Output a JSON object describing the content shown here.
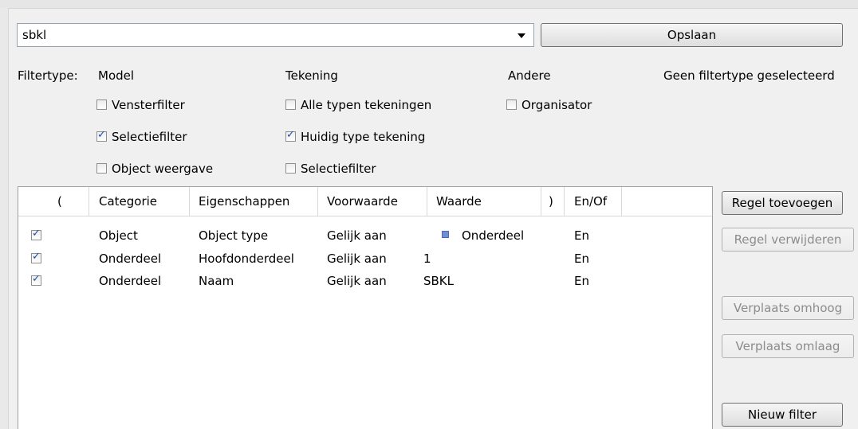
{
  "filter_name": "sbkl",
  "save_label": "Opslaan",
  "filtertype": {
    "label": "Filtertype:",
    "groups": {
      "model": "Model",
      "drawing": "Tekening",
      "other": "Andere",
      "none_selected": "Geen filtertype geselecteerd"
    },
    "model_options": [
      {
        "label": "Vensterfilter",
        "checked": false
      },
      {
        "label": "Selectiefilter",
        "checked": true
      },
      {
        "label": "Object weergave",
        "checked": false
      }
    ],
    "drawing_options": [
      {
        "label": "Alle typen tekeningen",
        "checked": false
      },
      {
        "label": "Huidig type tekening",
        "checked": true
      },
      {
        "label": "Selectiefilter",
        "checked": false
      }
    ],
    "other_options": [
      {
        "label": "Organisator",
        "checked": false
      }
    ]
  },
  "table": {
    "columns": [
      "(",
      "Categorie",
      "Eigenschappen",
      "Voorwaarde",
      "Waarde",
      ")",
      "En/Of"
    ],
    "rows": [
      {
        "checked": true,
        "category": "Object",
        "property": "Object type",
        "condition": "Gelijk aan",
        "value": "Onderdeel",
        "value_icon": "part-icon",
        "andor": "En"
      },
      {
        "checked": true,
        "category": "Onderdeel",
        "property": "Hoofdonderdeel",
        "condition": "Gelijk aan",
        "value": "1",
        "andor": "En"
      },
      {
        "checked": true,
        "category": "Onderdeel",
        "property": "Naam",
        "condition": "Gelijk aan",
        "value": "SBKL",
        "andor": "En"
      }
    ]
  },
  "actions": {
    "add_row": "Regel toevoegen",
    "remove_row": "Regel verwijderen",
    "move_up": "Verplaats omhoog",
    "move_down": "Verplaats omlaag",
    "new_filter": "Nieuw filter"
  },
  "colors": {
    "check_mark": "#1d4fa8",
    "disabled_text": "#8c8c8c",
    "value_icon": "#6f8fd4"
  }
}
